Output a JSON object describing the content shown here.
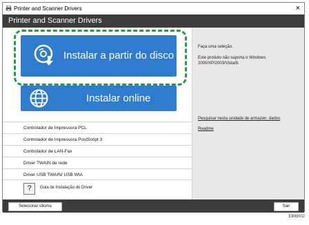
{
  "window": {
    "title": "Printer and Scanner Drivers",
    "close_glyph": "×"
  },
  "header": {
    "title": "Printer and Scanner Drivers"
  },
  "main": {
    "install_disk_label": "Instalar a partir do disco",
    "install_online_label": "Instalar online",
    "driver_list": [
      "Controlador de Impressora PCL",
      "Controlador de Impressora PostScript 3",
      "Controlador de LAN-Fax",
      "Driver TWAIN de rede",
      "Driver USB TWAIN/ USB WIA"
    ],
    "guide_icon": "?",
    "guide_label": "Guia de Instalação do Driver"
  },
  "right": {
    "prompt": "Faça uma seleção.",
    "support_line1": "Este produto não suporta o Windows",
    "support_line2": "2000/XP/2003/Vista/8.",
    "link_search": "Pesquisar nesta unidade de armazen. dados",
    "link_readme": "Readme"
  },
  "footer": {
    "select_language": "Selecionar idioma",
    "exit": "Sair"
  },
  "figure_code": "EBW002",
  "colors": {
    "accent_blue": "#2f7bd0",
    "dark_bar": "#3c3c3c",
    "highlight_dash": "#1f9c4c",
    "right_panel": "#e8e8e8"
  },
  "icons": {
    "app": "printer-icon",
    "disk": "disc-download-icon",
    "online": "globe-icon",
    "guide": "question-icon"
  }
}
